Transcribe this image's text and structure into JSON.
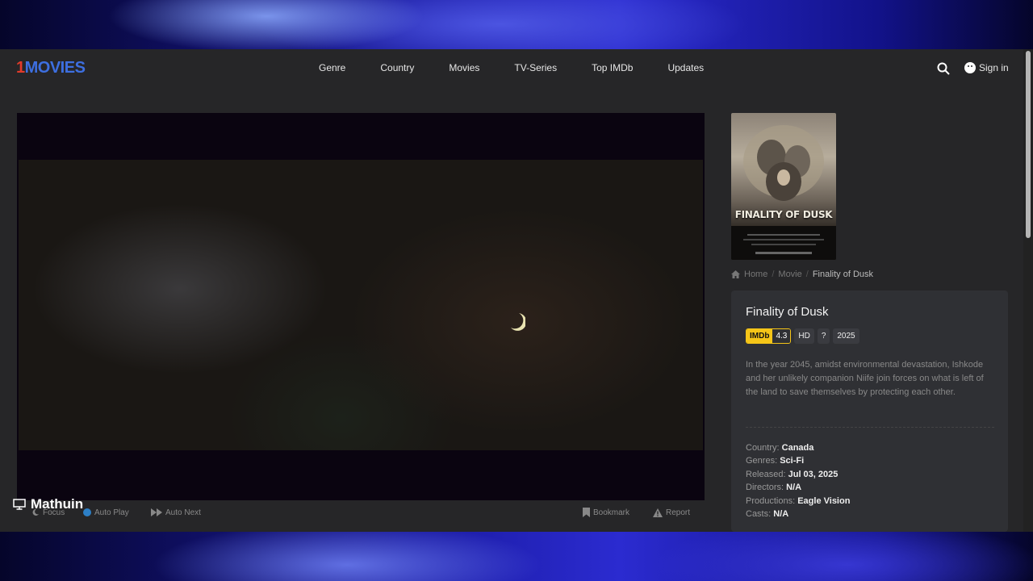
{
  "header": {
    "logo_prefix": "1",
    "logo_text": "MOVIES",
    "nav": [
      "Genre",
      "Country",
      "Movies",
      "TV-Series",
      "Top IMDb",
      "Updates"
    ],
    "signin_label": "Sign in"
  },
  "player": {
    "controls": {
      "focus": "Focus",
      "autoplay": "Auto Play",
      "autonext": "Auto Next",
      "bookmark": "Bookmark",
      "report": "Report"
    },
    "overlay_label": "Mathuin"
  },
  "poster": {
    "title_text": "FINALITY OF DUSK"
  },
  "breadcrumb": {
    "home": "Home",
    "movie": "Movie",
    "current": "Finality of Dusk"
  },
  "movie": {
    "title": "Finality of Dusk",
    "imdb_label": "IMDb",
    "imdb_score": "4.3",
    "quality": "HD",
    "rating": "?",
    "year": "2025",
    "description": "In the year 2045, amidst environmental devastation, Ishkode and her unlikely companion Niife join forces on what is left of the land to save themselves by protecting each other.",
    "meta": {
      "country_label": "Country:",
      "country": "Canada",
      "genres_label": "Genres:",
      "genres": "Sci-Fi",
      "released_label": "Released:",
      "released": "Jul 03, 2025",
      "directors_label": "Directors:",
      "directors": "N/A",
      "productions_label": "Productions:",
      "productions": "Eagle Vision",
      "casts_label": "Casts:",
      "casts": "N/A"
    }
  },
  "icons": {
    "search": "search-icon",
    "user": "user-icon",
    "home": "home-icon",
    "bookmark": "bookmark-icon",
    "report": "warning-icon",
    "focus": "moon-icon",
    "monitor": "monitor-icon"
  },
  "colors": {
    "imdb_yellow": "#f5c518",
    "logo_red": "#e23b2a",
    "logo_blue": "#3d6fe0",
    "autoplay_blue": "#2d7fc6"
  }
}
